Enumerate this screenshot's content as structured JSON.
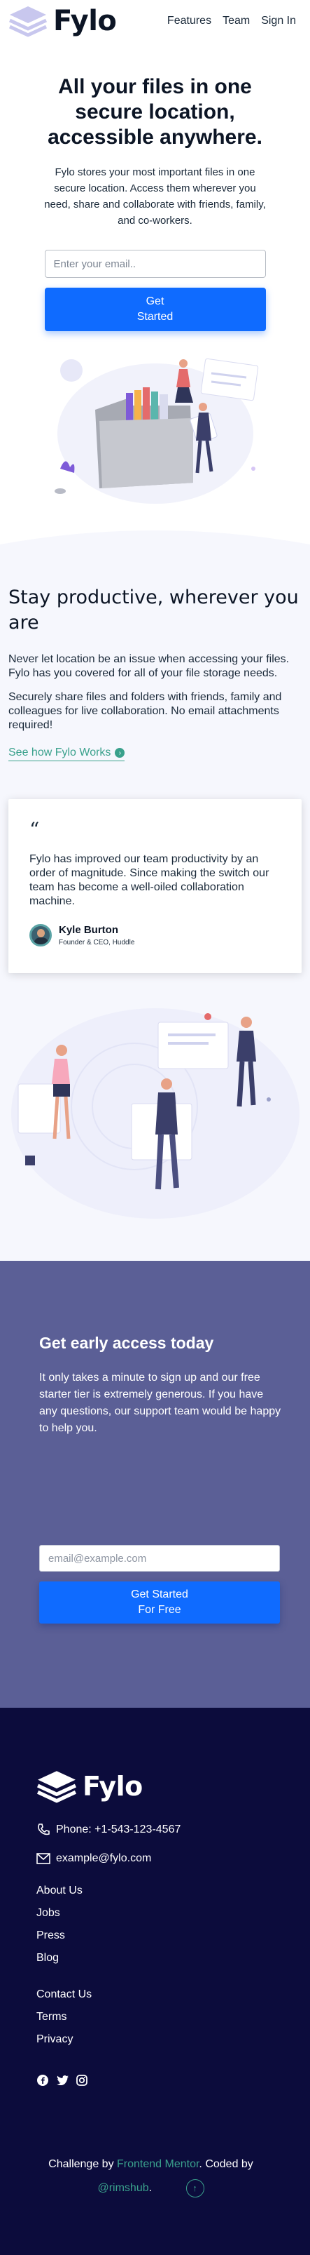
{
  "brand": {
    "name": "Fylo"
  },
  "nav": {
    "items": [
      "Features",
      "Team",
      "Sign In"
    ]
  },
  "hero": {
    "title": "All your files in one secure location, accessible anywhere.",
    "body": "Fylo stores your most important files in one secure location. Access them wherever you need, share and collaborate with friends, family, and co-workers.",
    "email_placeholder": "Enter your email..",
    "cta_line1": "Get",
    "cta_line2": "Started"
  },
  "productive": {
    "title": "Stay productive, wherever you are",
    "para1": "Never let location be an issue when accessing your files. Fylo has you covered for all of your file storage needs.",
    "para2": "Securely share files and folders with friends, family and colleagues for live collaboration. No email attachments required!",
    "link": "See how Fylo Works",
    "link_icon": "arrow-right-icon"
  },
  "testimonial": {
    "quote_mark": "“",
    "text": "Fylo has improved our team productivity by an order of magnitude. Since making the switch our team has become a well-oiled collaboration machine.",
    "name": "Kyle Burton",
    "role": "Founder & CEO, Huddle"
  },
  "access": {
    "title": "Get early access today",
    "body": "It only takes a minute to sign up and our free starter tier is extremely generous. If you have any questions, our support team would be happy to help you.",
    "email_placeholder": "email@example.com",
    "cta_line1": "Get Started",
    "cta_line2": "For Free"
  },
  "footer": {
    "phone": "Phone: +1-543-123-4567",
    "email": "example@fylo.com",
    "links1": [
      "About Us",
      "Jobs",
      "Press",
      "Blog"
    ],
    "links2": [
      "Contact Us",
      "Terms",
      "Privacy"
    ],
    "social_icons": [
      "facebook-icon",
      "twitter-icon",
      "instagram-icon"
    ],
    "attribution_prefix": "Challenge by ",
    "attribution_link1": "Frontend Mentor",
    "attribution_mid": ". Coded by",
    "attribution_link2": "@rimshub",
    "attribution_end": "."
  },
  "colors": {
    "primary_blue": "#0f6bff",
    "teal_link": "#3aa18c",
    "access_bg": "#5b5f96",
    "footer_bg": "#0c0c3c",
    "light_bg": "#f6f7fd"
  }
}
